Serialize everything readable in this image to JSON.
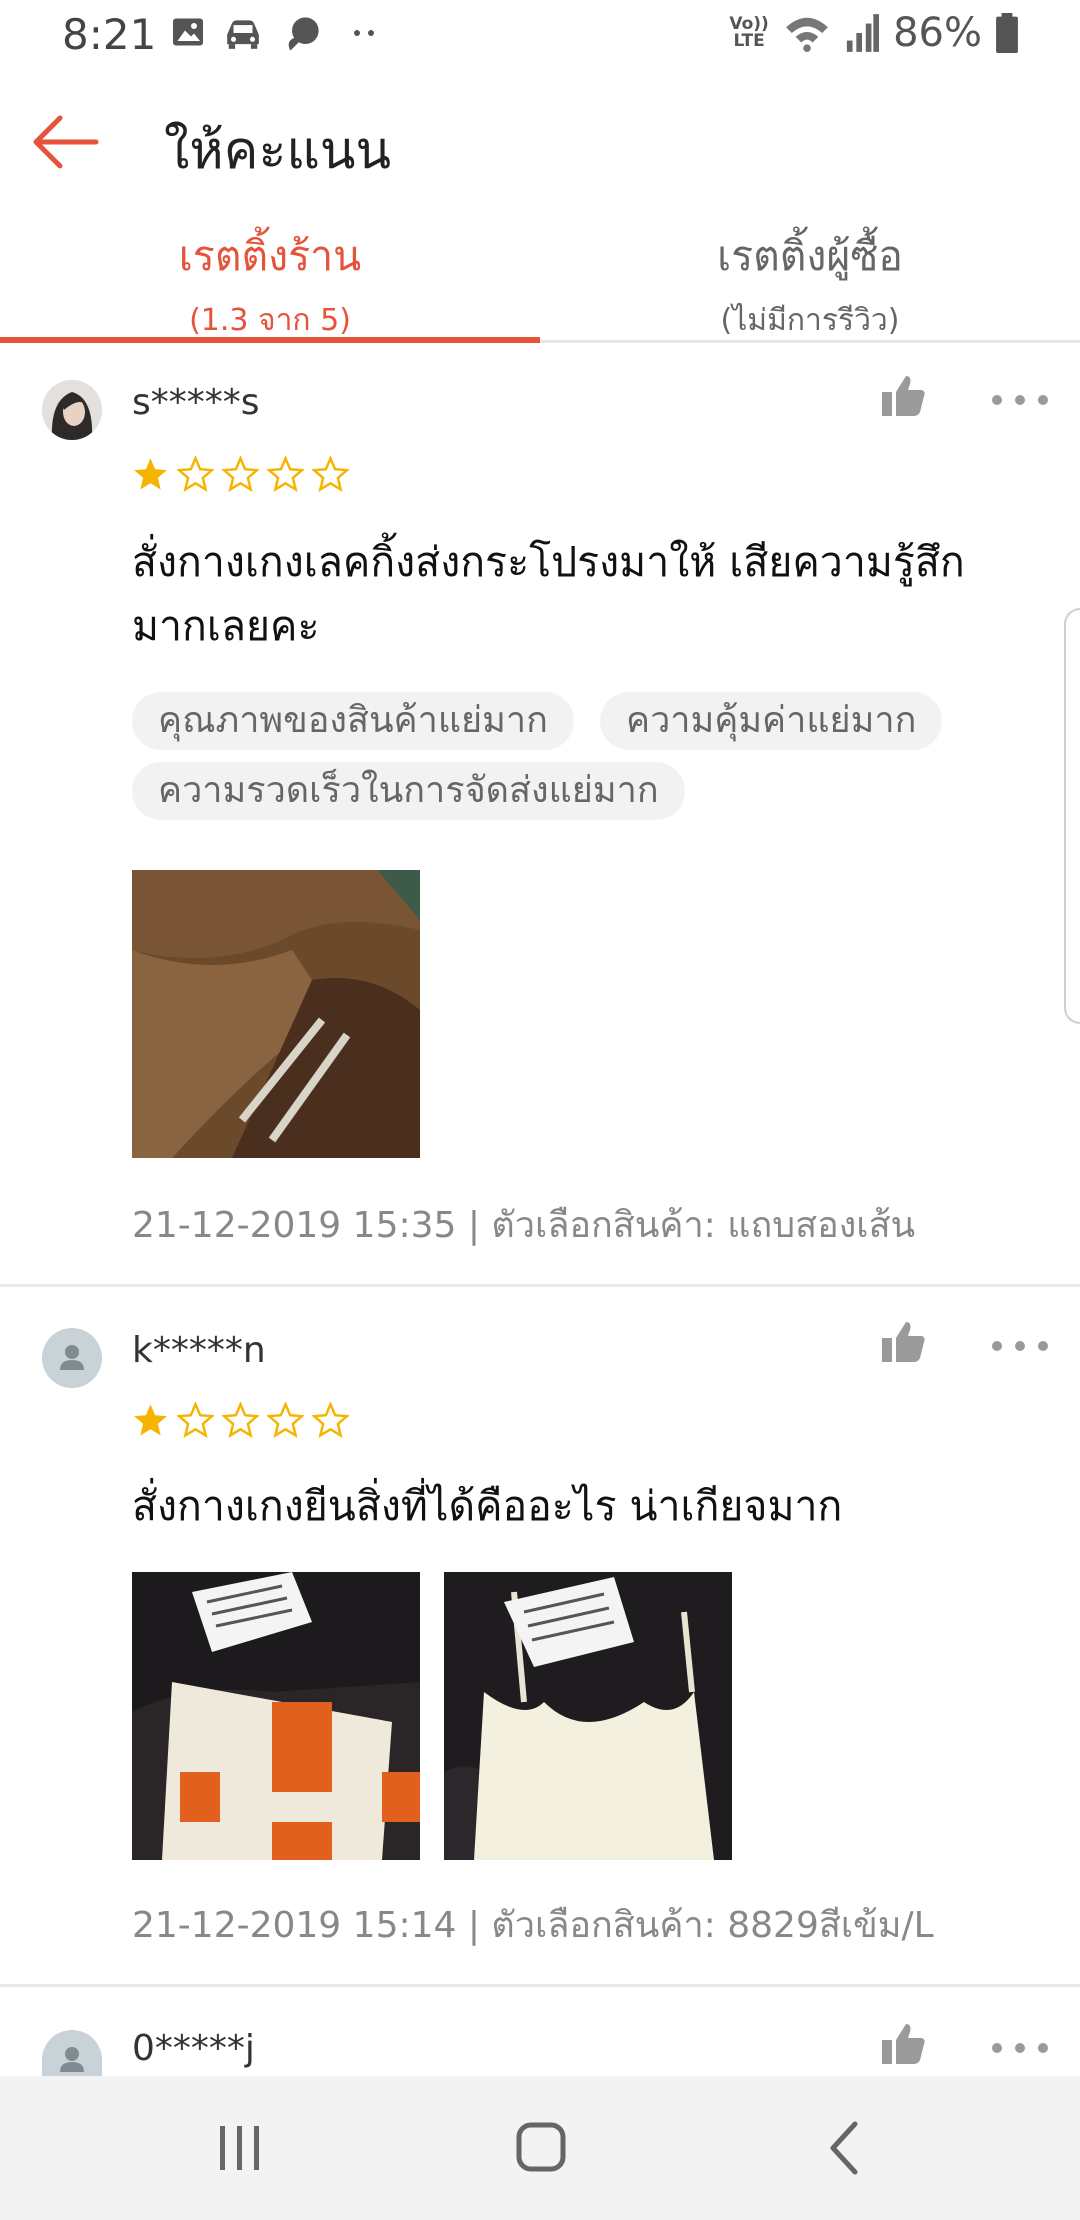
{
  "status_bar": {
    "time": "8:21",
    "network_label": "Vo)) LTE",
    "battery": "86%",
    "icons": [
      "image-icon",
      "car-icon",
      "chat-icon",
      "more-dots-icon",
      "wifi-icon",
      "signal-icon",
      "battery-icon"
    ]
  },
  "header": {
    "title": "ให้คะแนน",
    "back_icon": "back-arrow-icon"
  },
  "tabs": [
    {
      "label": "เรตติ้งร้าน",
      "sub": "(1.3 จาก 5)",
      "active": true
    },
    {
      "label": "เรตติ้งผู้ซื้อ",
      "sub": "(ไม่มีการรีวิว)",
      "active": false
    }
  ],
  "reviews": [
    {
      "username": "s*****s",
      "rating": 1,
      "max_rating": 5,
      "text": "สั่งกางเกงเลคกิ้งส่งกระโปรงมาให้  เสียความรู้สึกมากเลยคะ",
      "tags": [
        "คุณภาพของสินค้าแย่มาก",
        "ความคุ้มค่าแย่มาก",
        "ความรวดเร็วในการจัดส่งแย่มาก"
      ],
      "photos": [
        "brown-fabric-photo"
      ],
      "meta": "21-12-2019 15:35 | ตัวเลือกสินค้า: แถบสองเส้น"
    },
    {
      "username": "k*****n",
      "rating": 1,
      "max_rating": 5,
      "text": "สั่งกางเกงยีนสิ่งที่ได้คืออะไร น่าเกียจมาก",
      "tags": [],
      "photos": [
        "package-photo",
        "white-camisole-photo"
      ],
      "meta": "21-12-2019 15:14 | ตัวเลือกสินค้า: 8829สีเข้ม/L"
    },
    {
      "username": "0*****j"
    }
  ],
  "colors": {
    "accent": "#e4533a",
    "star": "#f5b400",
    "tag_bg": "#f2f2f2",
    "muted_text": "#888888"
  },
  "nav_bar": {
    "icons": [
      "recent-apps-icon",
      "home-icon",
      "nav-back-icon"
    ]
  }
}
